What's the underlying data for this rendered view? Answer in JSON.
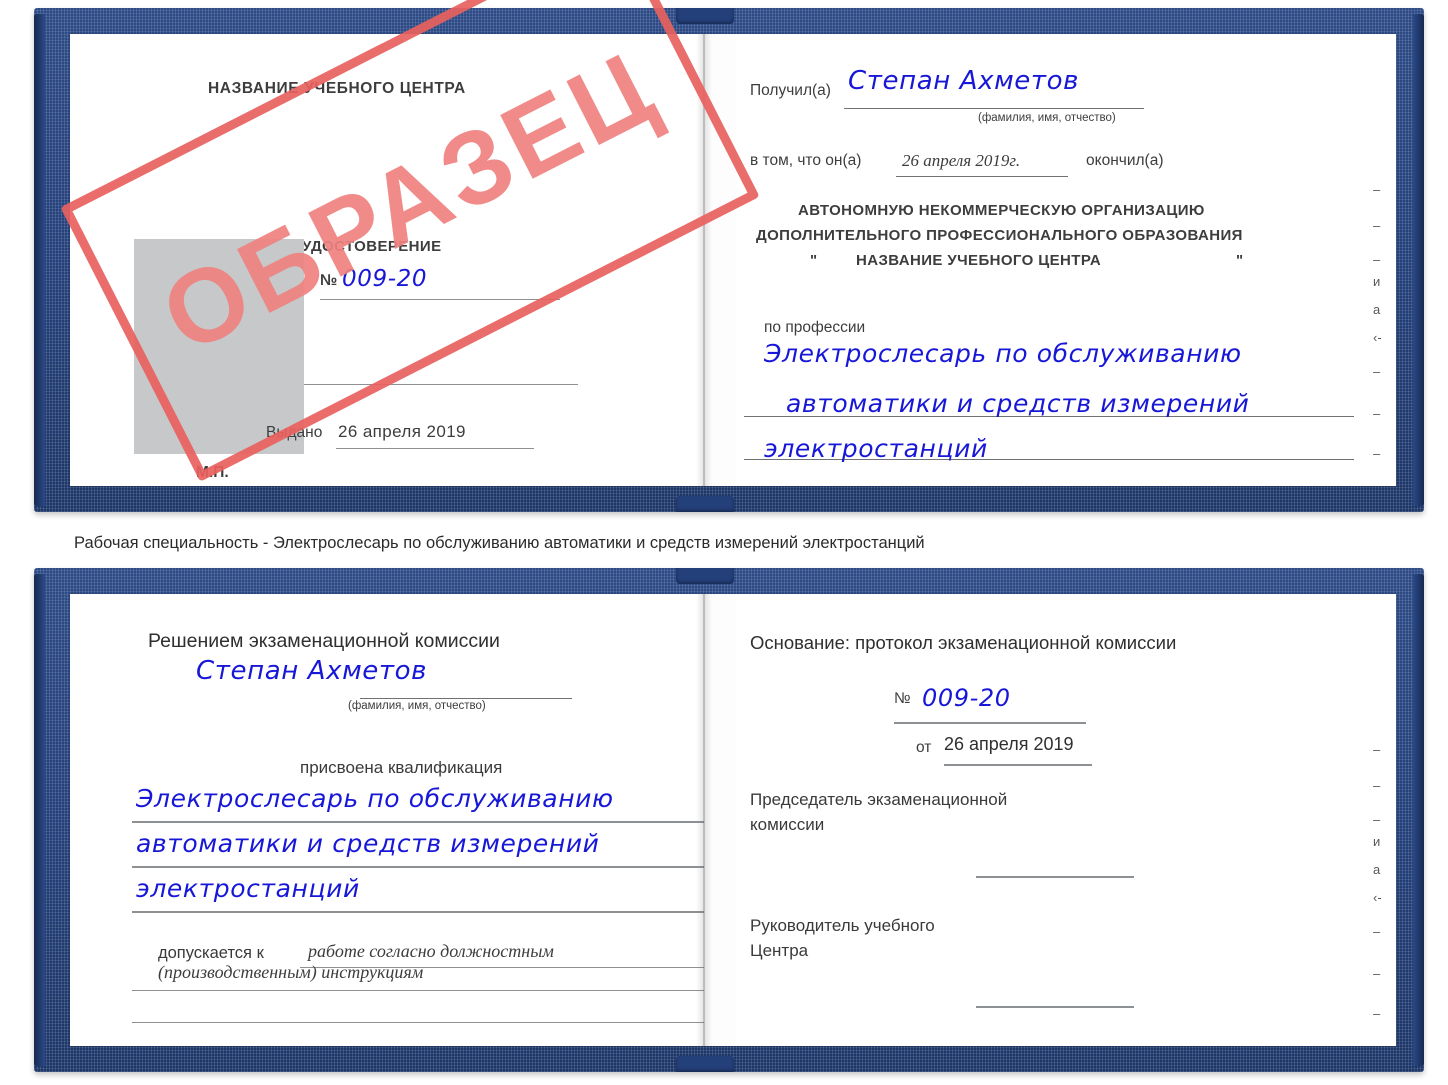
{
  "colors": {
    "cover_blue": "#24407a",
    "stamp_red": "#e8615e",
    "handwriting_blue": "#1717d8",
    "photo_gray": "#c6c8c9",
    "rule_gray": "#8e9194"
  },
  "caption": {
    "text": "Рабочая специальность - Электрослесарь по обслуживанию автоматики и средств измерений электростанций"
  },
  "certificate_top": {
    "left_page": {
      "org_title": "НАЗВАНИЕ УЧЕБНОГО ЦЕНТРА",
      "doc_type": "УДОСТОВЕРЕНИЕ",
      "number_label": "№",
      "number_value": "009-20",
      "issued_label": "Выдано",
      "issued_value": "26 апреля 2019",
      "seal_label": "М.П.",
      "photo_placeholder": "photo-box"
    },
    "right_page": {
      "received_label": "Получил(а)",
      "received_value": "Степан Ахметов",
      "received_hint": "(фамилия, имя, отчество)",
      "that_he_label": "в том, что он(а)",
      "that_he_value": "26 апреля 2019г.",
      "finished_label": "окончил(а)",
      "org_line1": "АВТОНОМНУЮ НЕКОММЕРЧЕСКУЮ ОРГАНИЗАЦИЮ",
      "org_line2": "ДОПОЛНИТЕЛЬНОГО ПРОФЕССИОНАЛЬНОГО ОБРАЗОВАНИЯ",
      "org_quote_open": "\"",
      "org_line3": "НАЗВАНИЕ УЧЕБНОГО ЦЕНТРА",
      "org_quote_close": "\"",
      "profession_label": "по профессии",
      "profession_line1": "Электрослесарь по обслуживанию",
      "profession_line2": "автоматики и средств измерений",
      "profession_line3": "электростанций"
    },
    "edge_fragments": [
      "–",
      "–",
      "–",
      "и",
      "а",
      "‹-",
      "–",
      "–",
      "–"
    ]
  },
  "certificate_bottom": {
    "left_page": {
      "decision_title": "Решением экзаменационной комиссии",
      "name_value": "Степан Ахметов",
      "name_hint": "(фамилия, имя, отчество)",
      "qualification_label": "присвоена квалификация",
      "qualification_line1": "Электрослесарь по обслуживанию",
      "qualification_line2": "автоматики и средств измерений",
      "qualification_line3": "электростанций",
      "allowed_label": "допускается к",
      "allowed_value_line1": "работе согласно должностным",
      "allowed_value_line2": "(производственным) инструкциям"
    },
    "right_page": {
      "basis_label": "Основание: протокол экзаменационной комиссии",
      "number_label": "№",
      "number_value": "009-20",
      "date_label": "от",
      "date_value": "26 апреля 2019",
      "chairman_line1": "Председатель экзаменационной",
      "chairman_line2": "комиссии",
      "head_line1": "Руководитель учебного",
      "head_line2": "Центра"
    },
    "edge_fragments": [
      "–",
      "–",
      "–",
      "и",
      "а",
      "‹-",
      "–",
      "–",
      "–"
    ]
  },
  "stamp": {
    "text": "ОБРАЗЕЦ"
  }
}
